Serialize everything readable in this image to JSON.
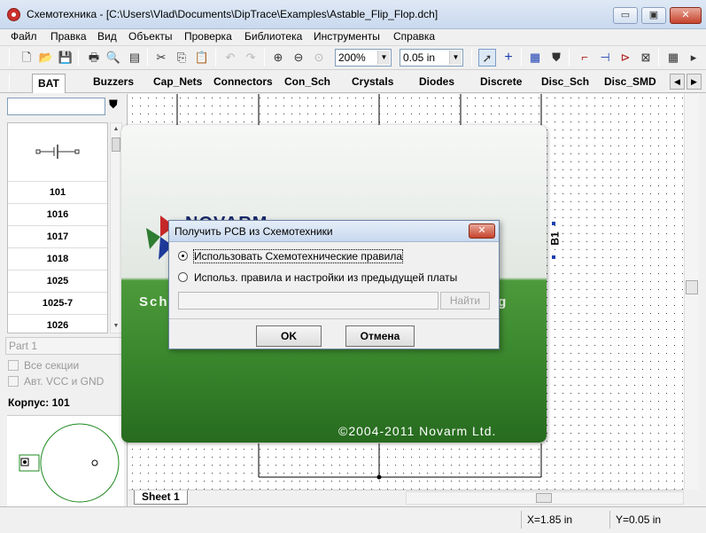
{
  "window": {
    "title": "Схемотехника - [C:\\Users\\Vlad\\Documents\\DipTrace\\Examples\\Astable_Flip_Flop.dch]",
    "min_label": "▭",
    "restore_label": "▣",
    "close_label": "✕"
  },
  "menu": {
    "items": [
      "Файл",
      "Правка",
      "Вид",
      "Объекты",
      "Проверка",
      "Библиотека",
      "Инструменты",
      "Справка"
    ]
  },
  "toolbar": {
    "zoom_value": "200%",
    "grid_value": "0.05 in",
    "icons": {
      "new": "🗋",
      "open": "📂",
      "save": "💾",
      "print": "🖶",
      "preview": "🔍",
      "report": "▤",
      "cut": "✂",
      "copy": "⎘",
      "paste": "📋",
      "undo": "↶",
      "redo": "↷",
      "zoom_in": "⊕",
      "zoom_out": "⊖",
      "zoom_fit": "⊙",
      "pointer": "➚",
      "cross": "+",
      "ic": "▦",
      "binocular": "⛊",
      "wire": "⌐",
      "bus": "⊣",
      "netport": "⊳",
      "compare": "⊠",
      "more": "▸"
    }
  },
  "libraries": {
    "tabs": [
      "BAT",
      "Buzzers",
      "Cap_Nets",
      "Connectors",
      "Con_Sch",
      "Crystals",
      "Diodes",
      "Discrete",
      "Disc_Sch",
      "Disc_SMD"
    ],
    "prev": "◀",
    "next": "▶"
  },
  "left_panel": {
    "search_value": "",
    "search_icon": "⛊",
    "components": [
      "101",
      "1016",
      "1017",
      "1018",
      "1025",
      "1025-7",
      "1026"
    ],
    "part_value": "Part 1",
    "all_sections": "Все секции",
    "auto_vcc": "Авт. VCC и GND",
    "package_label": "Корпус: 101"
  },
  "canvas": {
    "sheet_tab": "Sheet 1",
    "designator": "B1"
  },
  "status": {
    "x": "X=1.85 in",
    "y": "Y=0.05 in"
  },
  "splash": {
    "brand": "NOVARM",
    "band_left": "Sch",
    "band_right": "ng",
    "copyright": "©2004-2011 Novarm Ltd."
  },
  "dialog": {
    "title": "Получить PCB из Схемотехники",
    "close_label": "✕",
    "option_use_schematic": "Использовать Схемотехнические правила",
    "option_use_previous": "Использ. правила и настройки из предыдущей платы",
    "file_path": "",
    "find_button": "Найти",
    "ok_button": "OK",
    "cancel_button": "Отмена"
  }
}
